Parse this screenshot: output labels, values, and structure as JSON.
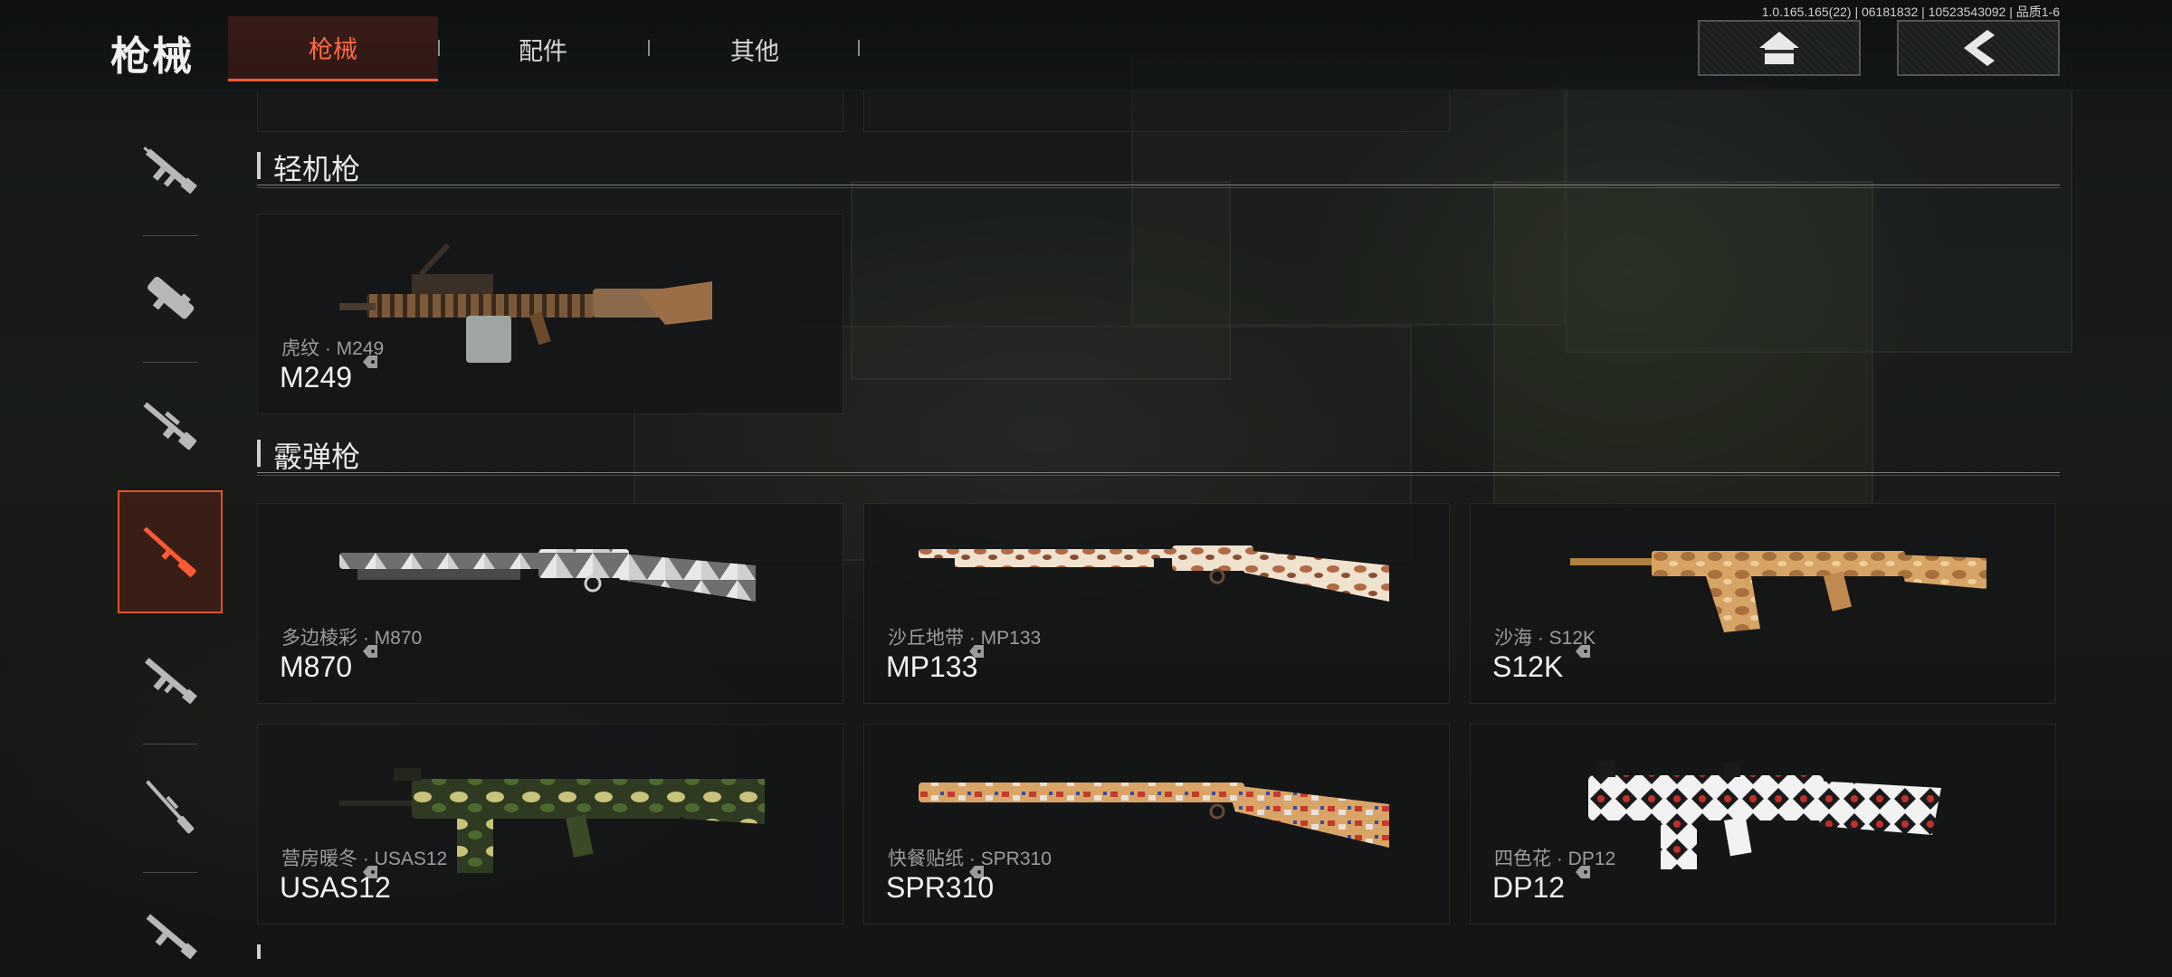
{
  "header": {
    "title": "枪械",
    "tabs": [
      {
        "label": "枪械",
        "active": true
      },
      {
        "label": "配件",
        "active": false
      },
      {
        "label": "其他",
        "active": false
      }
    ],
    "version": "1.0.165.165(22) | 06181832 | 10523543092 | 品质1-6",
    "home_icon": "home-icon",
    "back_icon": "back-arrow-icon"
  },
  "sidebar": {
    "categories": [
      {
        "icon": "assault-rifle-icon",
        "active": false
      },
      {
        "icon": "smg-icon",
        "active": false
      },
      {
        "icon": "marksman-rifle-icon",
        "active": false
      },
      {
        "icon": "shotgun-icon",
        "active": true
      },
      {
        "icon": "rifle-icon",
        "active": false
      },
      {
        "icon": "sniper-rifle-icon",
        "active": false
      },
      {
        "icon": "pistol-rifle-icon",
        "active": false
      }
    ]
  },
  "sections": {
    "lmg": {
      "title": "轻机枪",
      "items": [
        {
          "skin": "虎纹 · M249",
          "name": "M249",
          "pattern": "tiger"
        }
      ]
    },
    "shotgun": {
      "title": "霰弹枪",
      "items": [
        {
          "skin": "多边棱彩 · M870",
          "name": "M870",
          "pattern": "polygon"
        },
        {
          "skin": "沙丘地带 · MP133",
          "name": "MP133",
          "pattern": "dune"
        },
        {
          "skin": "沙海 · S12K",
          "name": "S12K",
          "pattern": "sand"
        },
        {
          "skin": "营房暖冬 · USAS12",
          "name": "USAS12",
          "pattern": "camo"
        },
        {
          "skin": "快餐贴纸 · SPR310",
          "name": "SPR310",
          "pattern": "sticker"
        },
        {
          "skin": "四色花 · DP12",
          "name": "DP12",
          "pattern": "diamond"
        }
      ]
    }
  },
  "colors": {
    "accent": "#ff5a36",
    "tab_active_text": "#ff6a45"
  }
}
